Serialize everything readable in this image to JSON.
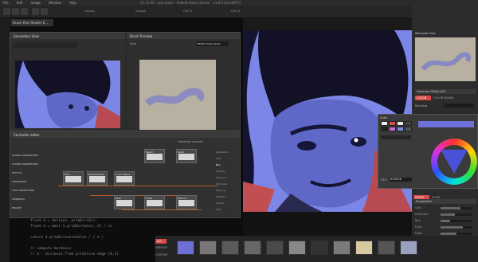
{
  "menubar": {
    "items": [
      "File",
      "Edit",
      "Image",
      "Window",
      "Help"
    ],
    "title": "12.13.09 - vois blase - Rebelle Beta internal - v1.8.0 [bld BETA]"
  },
  "toolbar": {
    "labels": [
      "Canvas",
      "Canvas",
      "Ctrl+Y",
      "Ctrl+Z",
      "OK"
    ]
  },
  "code_tab": {
    "label": "Brush Post Shader E..."
  },
  "code_lines": [
    "float d = dot(pos, primDir[0]);",
    "float d = max(-1.primDistance, d) / sz",
    "",
    "return 1.primDistanceValue / ( d )",
    "",
    "// compute Hardness",
    "// d - distance from primitive edge [0,1]"
  ],
  "panel_geo": {
    "title": "Secondary View"
  },
  "panel_brush": {
    "title": "Brush Preview",
    "view_label": "View",
    "select_value": "BMOD Chalk pastel"
  },
  "controller": {
    "title": "Controller editor",
    "dropdown": "Generate scenario",
    "categories": [
      "GLOBAL PARAMETERS",
      "STROKE PARAMETERS",
      "PATH FX",
      "OPERATORS",
      "CAKE OPERATIONS",
      "GENERALS",
      "ENGINE"
    ],
    "nodes": [
      "Prim",
      "Stroke Preset",
      "Color Select",
      "Blend",
      "Rand",
      "Fade",
      "Noise",
      "Blend 2"
    ],
    "outputs": [
      "Saturation",
      "Size",
      "Blur",
      "Opacity",
      "Gradient",
      "Hardness",
      "Spacing",
      "Rotation",
      "Scatter",
      "Jitter"
    ]
  },
  "right_panel": {
    "preview_label": "Wildcode Clips",
    "tabs": [
      "Hardness Offset (XY)",
      "COLOR",
      "COLOR MASKS"
    ],
    "blending_label": "Blending",
    "color_title": "Color",
    "hex_label": "HEX",
    "hex_value": "6C6FD6",
    "shape_tabs": [
      "SHAPE",
      "FLOW"
    ],
    "shape_title": "Shape/Jitter",
    "sliders": [
      {
        "label": "Size",
        "value": 0.62
      },
      {
        "label": "Hardness",
        "value": 0.45
      },
      {
        "label": "Blur",
        "value": 0.3
      },
      {
        "label": "Flow",
        "value": 0.7
      },
      {
        "label": "Fade",
        "value": 0.5
      },
      {
        "label": "Smoothing",
        "value": 0.4
      },
      {
        "label": "Angle",
        "value": 0.55
      },
      {
        "label": "Jitter",
        "value": 0.2
      }
    ]
  },
  "bottom": {
    "labels": [
      "ALL",
      "DEFAULT",
      "CUSTOM"
    ]
  },
  "colors": {
    "canvas": "#7b86e6",
    "accent": "#d54a48",
    "highlight": "#6c6fd6"
  }
}
